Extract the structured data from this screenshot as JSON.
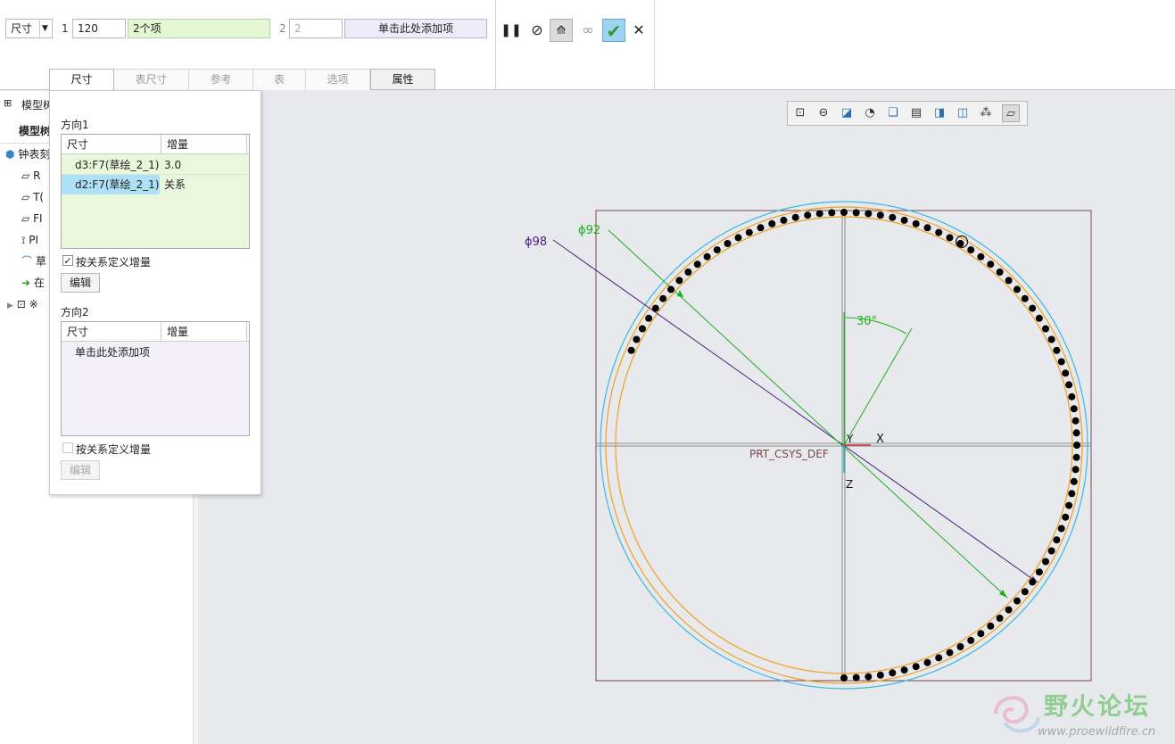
{
  "ribbon": {
    "type_select": "尺寸",
    "dir1_index": "1",
    "dir1_count": "120",
    "dir1_items": "2个项",
    "dir2_index": "2",
    "dir2_count_placeholder": "2",
    "dir2_add": "单击此处添加项",
    "tabs": [
      "尺寸",
      "表尺寸",
      "参考",
      "表",
      "选项",
      "属性"
    ]
  },
  "model_tree": {
    "header_title": "模型树",
    "subheader": "模型树",
    "root": "钟表刻",
    "items": [
      "R",
      "T(",
      "FI",
      "PI",
      "草",
      "在",
      "※"
    ]
  },
  "popup": {
    "dir1_title": "方向1",
    "col_dim": "尺寸",
    "col_inc": "增量",
    "dir1_rows": [
      {
        "dim": "d3:F7(草绘_2_1)",
        "inc": "3.0"
      },
      {
        "dim": "d2:F7(草绘_2_1)",
        "inc": "关系"
      }
    ],
    "dir1_rel_checkbox": "按关系定义增量",
    "dir1_rel_checked": true,
    "edit_button": "编辑",
    "dir2_title": "方向2",
    "dir2_add": "单击此处添加项",
    "dir2_rel_checkbox": "按关系定义增量",
    "dir2_rel_checked": false,
    "edit_button2": "编辑"
  },
  "canvas": {
    "dim_outer": "ϕ98",
    "dim_inner": "ϕ92",
    "angle": "30°",
    "axis_x": "X",
    "axis_y": "Y",
    "axis_z": "Z",
    "csys": "PRT_CSYS_DEF"
  },
  "watermark": {
    "title": "野火论坛",
    "url": "www.proewildfire.cn"
  },
  "colors": {
    "selected_row": "#aee0f7",
    "table_bg": "#e9f8dc",
    "dir2_bg": "#f3f0fb",
    "confirm_green": "#2e9b2e",
    "orange_circle": "#f0a020",
    "cyan_circle": "#38b8e8",
    "dim_green": "#1cb01c",
    "dim_purple": "#4b1a8c"
  }
}
